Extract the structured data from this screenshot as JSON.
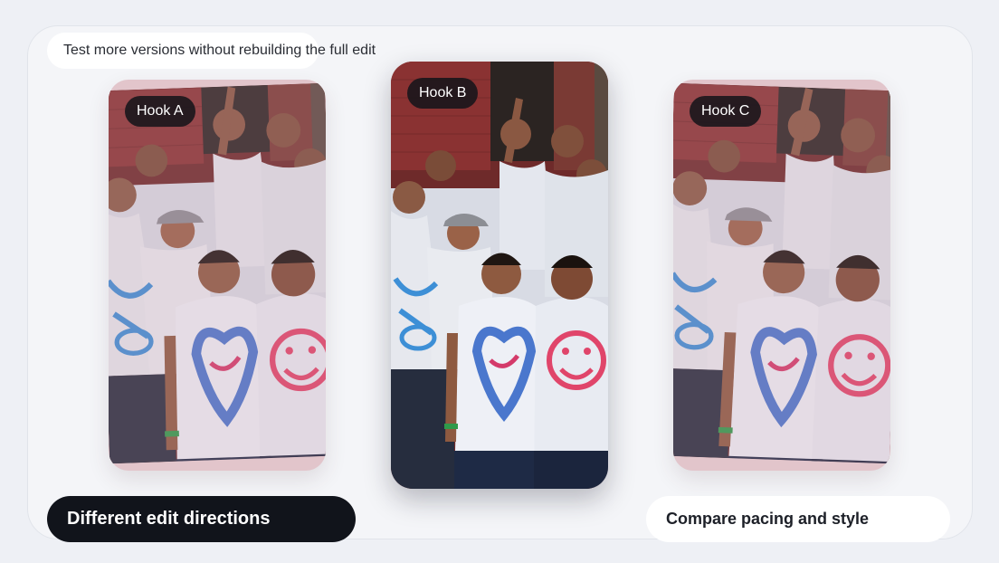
{
  "header": {
    "caption": "Test more versions without rebuilding the full edit"
  },
  "variants": [
    {
      "label": "Hook A"
    },
    {
      "label": "Hook B"
    },
    {
      "label": "Hook C"
    }
  ],
  "footer": {
    "left_label": "Different edit directions",
    "right_label": "Compare pacing and style"
  },
  "colors": {
    "page_bg": "#eef0f5",
    "card_bg": "#f4f5f8",
    "dark_pill": "#11141b",
    "tag_bg": "#14141a",
    "side_frame_tint": "#e2c5cb"
  }
}
